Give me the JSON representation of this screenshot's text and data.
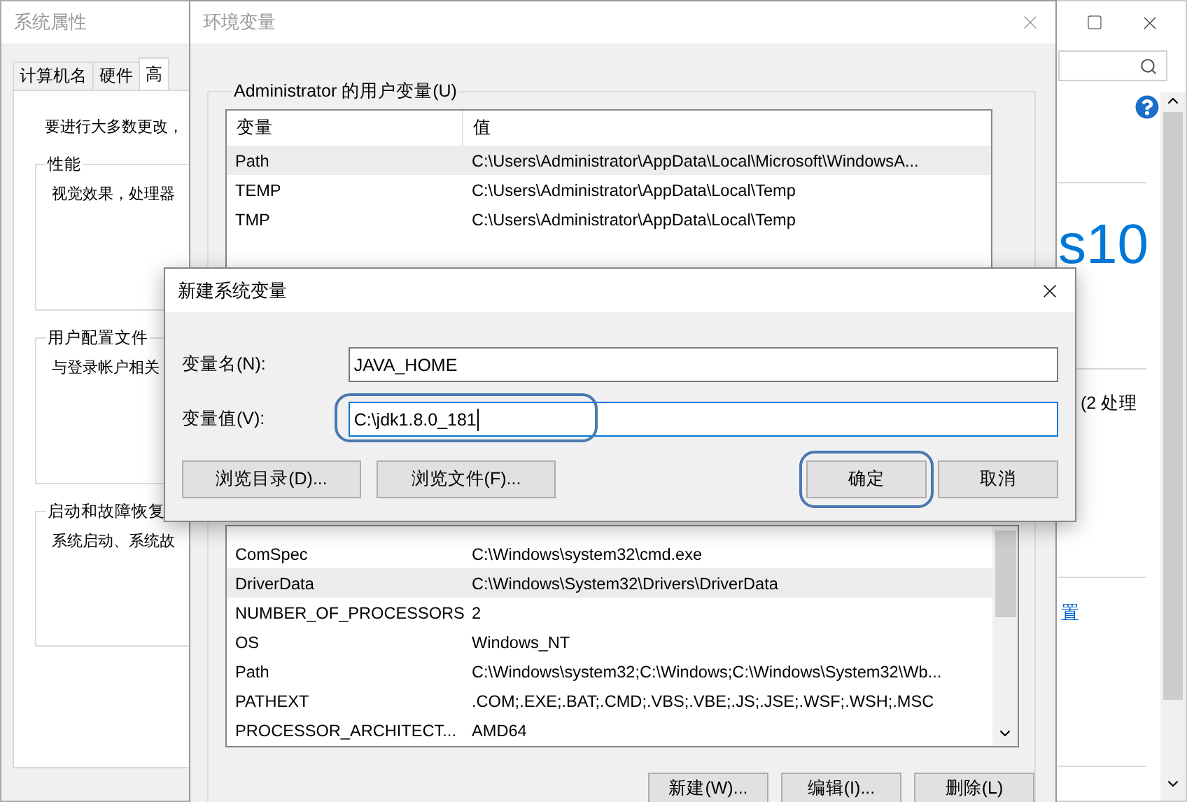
{
  "system_properties": {
    "title": "系统属性",
    "tabs": [
      {
        "label": "计算机名",
        "selected": false
      },
      {
        "label": "硬件",
        "selected": false
      },
      {
        "label": "高",
        "selected": true
      }
    ],
    "intro": "要进行大多数更改，",
    "groups": [
      {
        "title": "性能",
        "text": "视觉效果，处理器"
      },
      {
        "title": "用户配置文件",
        "text": "与登录帐户相关"
      },
      {
        "title": "启动和故障恢复",
        "text": "系统启动、系统故"
      }
    ]
  },
  "settings_window": {
    "heading": "s10",
    "detail": "(2 处理",
    "link": "置"
  },
  "environment_variables": {
    "title": "环境变量",
    "user_group": "Administrator 的用户变量(U)",
    "user_columns": [
      "变量",
      "值"
    ],
    "user_rows": [
      {
        "name": "Path",
        "value": "C:\\Users\\Administrator\\AppData\\Local\\Microsoft\\WindowsA...",
        "selected": true
      },
      {
        "name": "TEMP",
        "value": "C:\\Users\\Administrator\\AppData\\Local\\Temp",
        "selected": false
      },
      {
        "name": "TMP",
        "value": "C:\\Users\\Administrator\\AppData\\Local\\Temp",
        "selected": false
      }
    ],
    "system_rows": [
      {
        "name": "ComSpec",
        "value": "C:\\Windows\\system32\\cmd.exe",
        "selected": false
      },
      {
        "name": "DriverData",
        "value": "C:\\Windows\\System32\\Drivers\\DriverData",
        "selected": true
      },
      {
        "name": "NUMBER_OF_PROCESSORS",
        "value": "2",
        "selected": false
      },
      {
        "name": "OS",
        "value": "Windows_NT",
        "selected": false
      },
      {
        "name": "Path",
        "value": "C:\\Windows\\system32;C:\\Windows;C:\\Windows\\System32\\Wb...",
        "selected": false
      },
      {
        "name": "PATHEXT",
        "value": ".COM;.EXE;.BAT;.CMD;.VBS;.VBE;.JS;.JSE;.WSF;.WSH;.MSC",
        "selected": false
      },
      {
        "name": "PROCESSOR_ARCHITECT...",
        "value": "AMD64",
        "selected": false
      }
    ],
    "buttons": [
      "新建(W)...",
      "编辑(I)...",
      "删除(L)"
    ]
  },
  "new_variable_dialog": {
    "title": "新建系统变量",
    "fields": [
      {
        "label": "变量名(N):",
        "value": "JAVA_HOME",
        "focused": false,
        "circled": false
      },
      {
        "label": "变量值(V):",
        "value": "C:\\jdk1.8.0_181",
        "focused": true,
        "circled": true
      }
    ],
    "browse_buttons": [
      "浏览目录(D)...",
      "浏览文件(F)..."
    ],
    "buttons": [
      {
        "label": "确定",
        "circled": true
      },
      {
        "label": "取消",
        "circled": false
      }
    ]
  }
}
